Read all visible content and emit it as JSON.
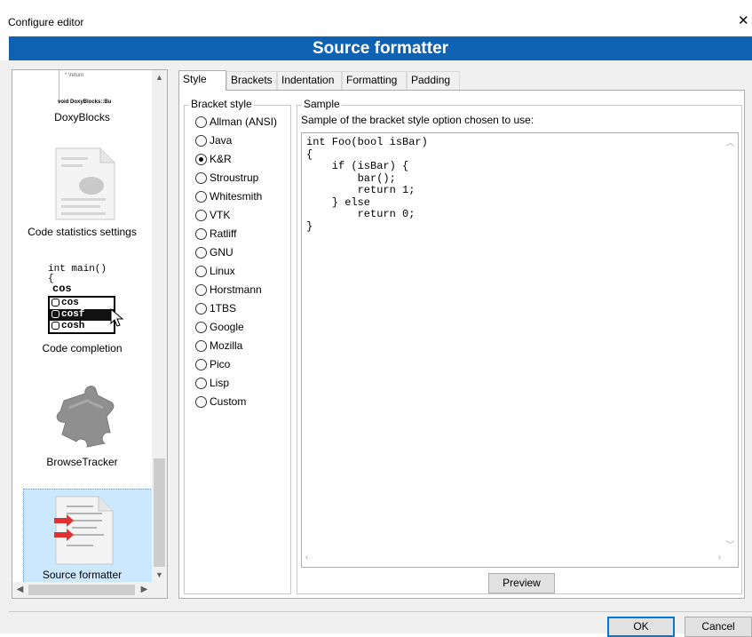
{
  "window": {
    "title": "Configure editor",
    "close_glyph": "✕"
  },
  "header": {
    "title": "Source formatter"
  },
  "sidebar": {
    "items": [
      {
        "label": "DoxyBlocks",
        "icon": "doxyblocks-icon",
        "thumb_line1": "* \\return",
        "thumb_line2": "void DoxyBlocks::Bu"
      },
      {
        "label": "Code statistics settings",
        "icon": "code-statistics-icon"
      },
      {
        "label": "Code completion",
        "icon": "code-completion-icon",
        "snippet_line1": "int main()",
        "snippet_line2": "{",
        "snippet_typed": "cos",
        "completions": [
          "cos",
          "cosf",
          "cosh"
        ]
      },
      {
        "label": "BrowseTracker",
        "icon": "puzzle-icon"
      },
      {
        "label": "Source formatter",
        "icon": "source-formatter-icon",
        "selected": true
      }
    ]
  },
  "tabs": [
    "Style",
    "Brackets",
    "Indentation",
    "Formatting",
    "Padding"
  ],
  "active_tab": "Style",
  "bracket_style": {
    "title": "Bracket style",
    "options": [
      "Allman (ANSI)",
      "Java",
      "K&R",
      "Stroustrup",
      "Whitesmith",
      "VTK",
      "Ratliff",
      "GNU",
      "Linux",
      "Horstmann",
      "1TBS",
      "Google",
      "Mozilla",
      "Pico",
      "Lisp",
      "Custom"
    ],
    "selected": "K&R"
  },
  "sample": {
    "title": "Sample",
    "description": "Sample of the bracket style option chosen to use:",
    "code": "int Foo(bool isBar)\n{\n    if (isBar) {\n        bar();\n        return 1;\n    } else\n        return 0;\n}"
  },
  "buttons": {
    "preview": "Preview",
    "ok": "OK",
    "cancel": "Cancel"
  },
  "colors": {
    "header_bg": "#0f61b1",
    "selection_bg": "#cce8ff",
    "dialog_bg": "#f0f0f0"
  }
}
